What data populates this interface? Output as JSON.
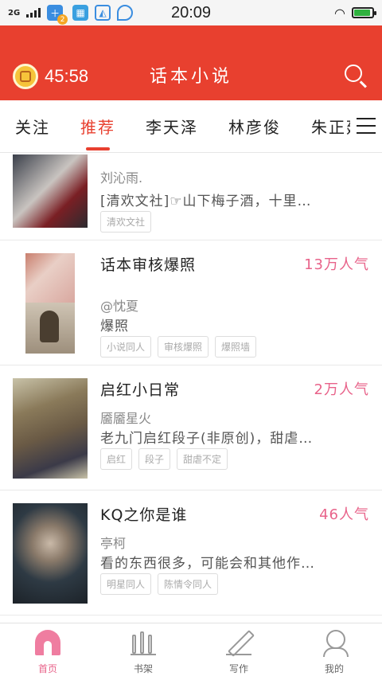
{
  "status_bar": {
    "network": "2G",
    "time": "20:09",
    "notification_badge": "2"
  },
  "header": {
    "timer": "45:58",
    "title": "话本小说"
  },
  "tabs": [
    {
      "label": "关注",
      "active": false
    },
    {
      "label": "推荐",
      "active": true
    },
    {
      "label": "李天泽",
      "active": false
    },
    {
      "label": "林彦俊",
      "active": false
    },
    {
      "label": "朱正廷",
      "active": false
    }
  ],
  "feed": [
    {
      "title": "",
      "popularity": "",
      "author": "刘沁雨.",
      "description": "[清欢文社]☞山下梅子酒，十里…",
      "tags": [
        "清欢文社"
      ],
      "thumb_colors": [
        "#3a3f4a",
        "#7a1f24",
        "#c9c4c0"
      ]
    },
    {
      "title": "话本审核爆照",
      "popularity": "13万人气",
      "author": "@忱夏",
      "description": "爆照",
      "tags": [
        "小说同人",
        "审核爆照",
        "爆照墙"
      ],
      "thumb_colors": [
        "#d9a8a0",
        "#e9cfc6",
        "#5a4a3a"
      ]
    },
    {
      "title": "启红小日常",
      "popularity": "2万人气",
      "author": "靥靥星火",
      "description": "老九门启红段子(非原创)，甜虐…",
      "tags": [
        "启红",
        "段子",
        "甜虐不定"
      ],
      "thumb_colors": [
        "#6a5a45",
        "#c8c2a8",
        "#3b3a48"
      ]
    },
    {
      "title": "KQ之你是谁",
      "popularity": "46人气",
      "author": "亭柯",
      "description": "看的东西很多，可能会和其他作…",
      "tags": [
        "明星同人",
        "陈情令同人"
      ],
      "thumb_colors": [
        "#2e3a44",
        "#c9b9a8",
        "#1c2228"
      ]
    }
  ],
  "bottom_nav": [
    {
      "label": "首页",
      "active": true,
      "icon": "home-icon"
    },
    {
      "label": "书架",
      "active": false,
      "icon": "bookshelf-icon"
    },
    {
      "label": "写作",
      "active": false,
      "icon": "pen-icon"
    },
    {
      "label": "我的",
      "active": false,
      "icon": "profile-icon"
    }
  ],
  "colors": {
    "accent": "#e8402f",
    "popularity": "#e8638a"
  }
}
